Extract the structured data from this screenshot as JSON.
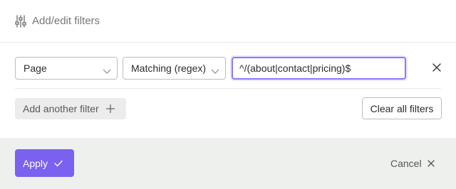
{
  "header": {
    "title": "Add/edit filters",
    "icon": "sliders-icon"
  },
  "filter": {
    "field": {
      "value": "Page",
      "icon": "chevron-down-icon"
    },
    "operator": {
      "value": "Matching (regex)",
      "icon": "chevron-down-icon"
    },
    "pattern": {
      "value": "^/(about|contact|pricing)$"
    },
    "remove_icon": "close-icon"
  },
  "actions": {
    "add_label": "Add another filter",
    "add_icon": "plus-icon",
    "clear_label": "Clear all filters"
  },
  "footer": {
    "apply_label": "Apply",
    "apply_icon": "check-icon",
    "cancel_label": "Cancel",
    "cancel_icon": "close-icon"
  },
  "colors": {
    "accent": "#7b61ef",
    "focus_border": "#8d79f5",
    "footer_bg": "#eef0ee"
  }
}
